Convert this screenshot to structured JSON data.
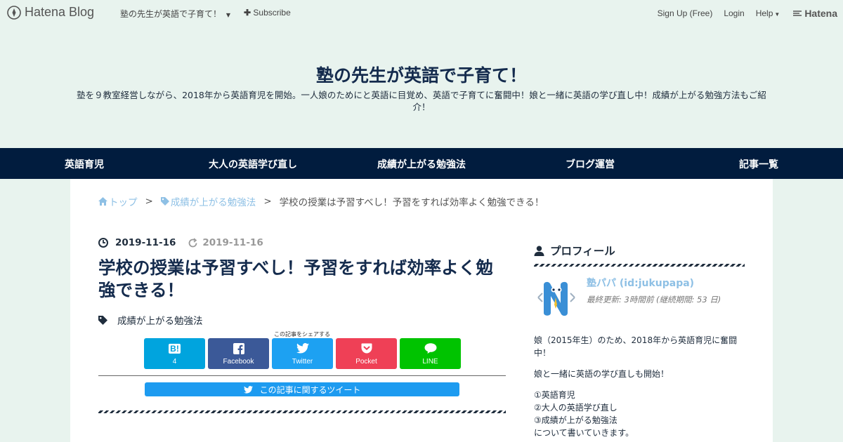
{
  "topbar": {
    "logo_text": "Hatena Blog",
    "blog_selector": "塾の先生が英語で子育て！",
    "subscribe": "Subscribe",
    "signup": "Sign Up (Free)",
    "login": "Login",
    "help": "Help",
    "brand": "Hatena"
  },
  "header": {
    "title": "塾の先生が英語で子育て！",
    "description": "塾を９教室経営しながら、2018年から英語育児を開始。一人娘のためにと英語に目覚め、英語で子育てに奮闘中！娘と一緒に英語の学び直し中！成績が上がる勉強方法もご紹介！"
  },
  "nav": [
    "英語育児",
    "大人の英語学び直し",
    "成績が上がる勉強法",
    "ブログ運営",
    "記事一覧"
  ],
  "breadcrumb": {
    "top": "トップ",
    "category": "成績が上がる勉強法",
    "separator": ">",
    "current": "学校の授業は予習すべし！予習をすれば効率よく勉強できる！"
  },
  "article": {
    "published": "2019-11-16",
    "updated": "2019-11-16",
    "title": "学校の授業は予習すべし！予習をすれば効率よく勉強できる！",
    "category": "成績が上がる勉強法",
    "share_caption": "この記事をシェアする",
    "share": {
      "hatebu_icon": "B!",
      "hatebu_count": "4",
      "facebook": "Facebook",
      "twitter": "Twitter",
      "pocket": "Pocket",
      "line": "LINE"
    },
    "tweet_label": "この記事に関するツイート"
  },
  "profile": {
    "heading": "プロフィール",
    "name": "塾パパ (id:jukupapa)",
    "updated": "最終更新: 3時間前 (継続期間: 53 日)",
    "bio1": "娘（2015年生）のため、2018年から英語育児に奮闘中！",
    "bio2": "娘と一緒に英語の学び直しも開始！",
    "list": [
      "①英語育児",
      "②大人の英語学び直し",
      "③成績が上がる勉強法",
      "について書いていきます。"
    ]
  },
  "colors": {
    "nav_bg": "#011c3e",
    "page_bg": "#e8f3ee",
    "hatebu": "#00a4de",
    "facebook": "#3b5998",
    "twitter": "#1da1f2",
    "pocket": "#ef4056",
    "line": "#00c300",
    "link": "#8ec0e5"
  },
  "icons": [
    "pen-icon",
    "plus-icon",
    "caret-down-icon",
    "hatena-logo-icon",
    "home-icon",
    "tag-icon",
    "clock-icon",
    "refresh-icon",
    "hatebu-icon",
    "facebook-icon",
    "twitter-icon",
    "pocket-icon",
    "line-icon",
    "user-icon"
  ]
}
